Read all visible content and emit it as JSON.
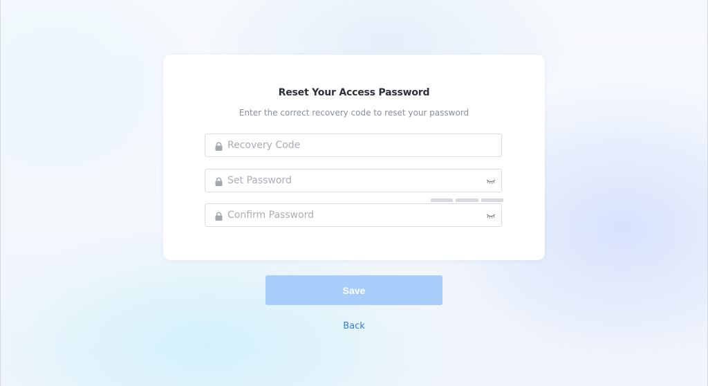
{
  "form": {
    "title": "Reset Your Access Password",
    "subtitle": "Enter the correct recovery code to reset your password",
    "fields": [
      {
        "placeholder": "Recovery Code",
        "icon": "lock-icon",
        "value": ""
      },
      {
        "placeholder": "Set Password",
        "icon": "lock-icon",
        "value": "",
        "toggle_icon": "eye-closed-icon"
      },
      {
        "placeholder": "Confirm Password",
        "icon": "lock-icon",
        "value": "",
        "toggle_icon": "eye-closed-icon"
      }
    ],
    "password_strength": {
      "segments_total": 3,
      "segments_filled": 0
    }
  },
  "actions": {
    "save_label": "Save",
    "back_label": "Back"
  },
  "colors": {
    "primary_disabled": "#a9cdfb",
    "link": "#2f7fd6",
    "title": "#2b2f36",
    "subtitle": "#8a8f98",
    "placeholder": "#a9adb4"
  }
}
